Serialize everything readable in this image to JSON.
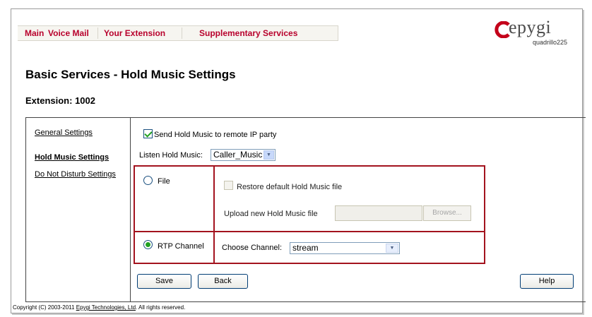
{
  "topnav": {
    "main": "Main",
    "voice_mail": "Voice Mail",
    "your_extension": "Your Extension",
    "supplementary_services": "Supplementary Services"
  },
  "logo": {
    "brand": "epygi",
    "model": "quadrillo225"
  },
  "page": {
    "title": "Basic Services - Hold Music Settings",
    "extension_label": "Extension: 1002"
  },
  "sidebar": {
    "items": [
      {
        "label": "General Settings",
        "active": false
      },
      {
        "label": "Hold Music Settings",
        "active": true
      },
      {
        "label": "Do Not Disturb Settings",
        "active": false
      }
    ]
  },
  "form": {
    "send_hold_music_label": "Send Hold Music to remote IP party",
    "send_hold_music_checked": true,
    "listen_label": "Listen Hold Music:",
    "listen_value": "Caller_Music",
    "file_label": "File",
    "file_selected": false,
    "restore_label": "Restore default Hold Music file",
    "upload_label": "Upload new Hold Music file",
    "upload_value": "",
    "browse_label": "Browse...",
    "rtp_label": "RTP Channel",
    "rtp_selected": true,
    "choose_channel_label": "Choose Channel:",
    "channel_value": "stream"
  },
  "buttons": {
    "save": "Save",
    "back": "Back",
    "help": "Help"
  },
  "footer": {
    "prefix": "Copyright (C) 2003-2011 ",
    "company": "Epygi Technologies, Ltd",
    "suffix": ". All rights reserved."
  },
  "colors": {
    "nav_text": "#b8002c",
    "highlight_border": "#a3131e",
    "check_green": "#21a121"
  }
}
